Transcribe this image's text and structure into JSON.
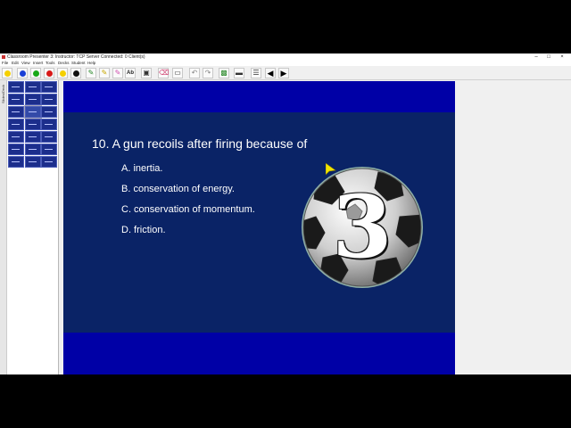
{
  "window": {
    "title": "Classroom Presenter 3: Instructor: TCP Server Connected: 0 Client(s)",
    "controls": {
      "minimize": "–",
      "maximize": "□",
      "close": "×"
    }
  },
  "menu": [
    "File",
    "Edit",
    "View",
    "Insert",
    "Tools",
    "Decks",
    "Student",
    "Help"
  ],
  "toolbar": {
    "pen_colors": [
      "#f5d000",
      "#1a3fd6",
      "#18a818",
      "#d81818",
      "#f5d000",
      "#111111"
    ],
    "text_tool_label": "Ab",
    "prev_icon": "◀",
    "next_icon": "▶"
  },
  "left_tab": {
    "label": "Slides/Deck 1"
  },
  "slide": {
    "question": "10.  A gun recoils after firing because of",
    "answers": [
      "A. inertia.",
      "B. conservation of energy.",
      "C. conservation of momentum.",
      "D. friction."
    ],
    "countdown": "3",
    "colors": {
      "band": "#0000a6",
      "body": "#0a2366",
      "text": "#ffffff"
    }
  }
}
